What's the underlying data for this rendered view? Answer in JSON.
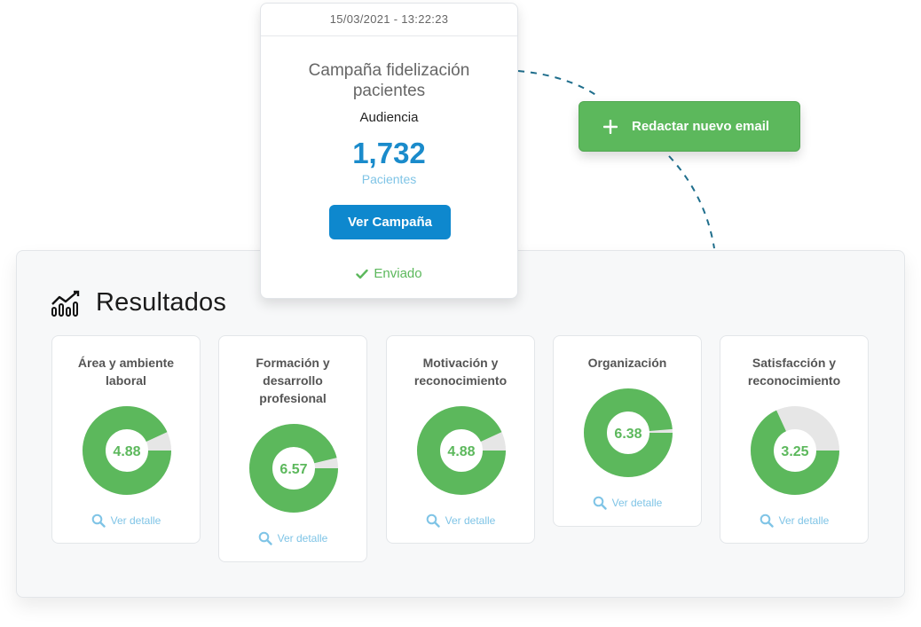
{
  "campaign": {
    "date": "15/03/2021 - 13:22:23",
    "name": "Campaña fidelización pacientes",
    "audience_label": "Audiencia",
    "audience_count": "1,732",
    "audience_unit": "Pacientes",
    "view_button": "Ver Campaña",
    "status": "Enviado"
  },
  "compose": {
    "label": "Redactar nuevo email"
  },
  "results": {
    "title": "Resultados",
    "detail_label": "Ver detalle",
    "cards": [
      {
        "title": "Área y ambiente laboral",
        "value": "4.88",
        "fraction": 0.93
      },
      {
        "title": "Formación y desarrollo profesional",
        "value": "6.57",
        "fraction": 0.96
      },
      {
        "title": "Motivación y reconocimiento",
        "value": "4.88",
        "fraction": 0.93
      },
      {
        "title": "Organización",
        "value": "6.38",
        "fraction": 0.985
      },
      {
        "title": "Satisfacción y reconocimiento",
        "value": "3.25",
        "fraction": 0.68
      }
    ]
  },
  "colors": {
    "green": "#5cb85c",
    "blue": "#0e88ce",
    "donut_track": "#e6e6e6",
    "link_blue": "#7fc4e6"
  },
  "icons": {
    "chart": "chart-bars-trend-icon",
    "search": "magnifier-icon",
    "check": "check-icon",
    "plus": "plus-icon"
  }
}
